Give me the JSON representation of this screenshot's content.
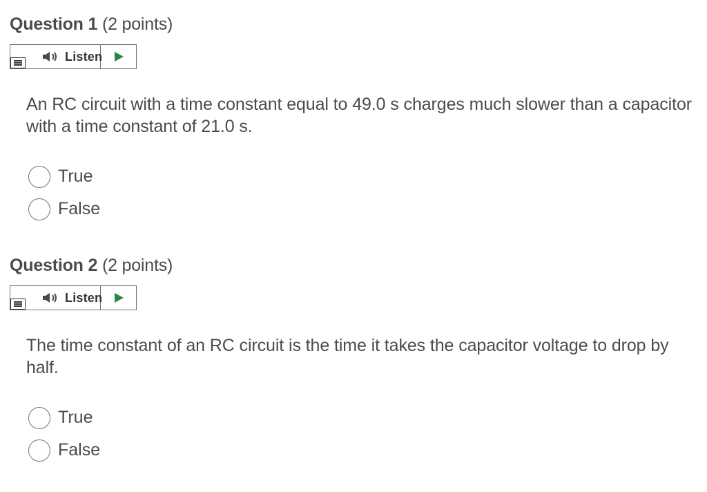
{
  "questions": [
    {
      "title": "Question 1",
      "points": "(2 points)",
      "listen_label": "Listen",
      "text": "An RC circuit with a time constant equal to 49.0 s charges much slower than a capacitor with a time constant of 21.0 s.",
      "options": [
        {
          "label": "True",
          "selected": false
        },
        {
          "label": "False",
          "selected": false
        }
      ]
    },
    {
      "title": "Question 2",
      "points": "(2 points)",
      "listen_label": "Listen",
      "text": "The time constant of an RC circuit is the time it takes the capacitor voltage to drop by half.",
      "options": [
        {
          "label": "True",
          "selected": false
        },
        {
          "label": "False",
          "selected": false
        }
      ]
    }
  ],
  "icons": {
    "menu": "menu-icon",
    "speaker": "speaker-icon",
    "play": "play-icon"
  },
  "colors": {
    "text": "#494c4e",
    "play_green": "#2e8540",
    "border": "#6e7477"
  }
}
